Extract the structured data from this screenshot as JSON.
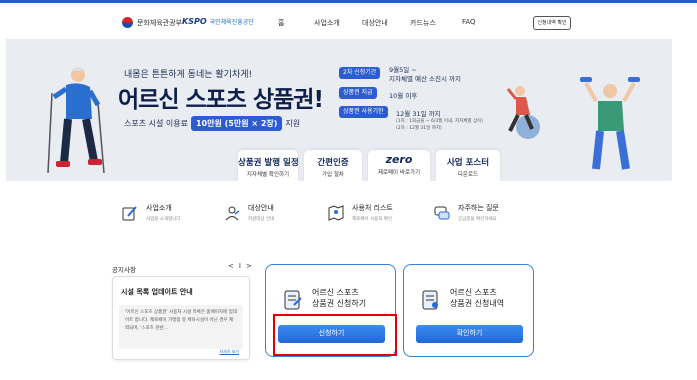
{
  "header": {
    "logo_mcst": "문화체육관광부",
    "logo_kspo_mark": "KSPO",
    "logo_kspo_sub": "국민체육진흥공단",
    "nav": [
      "홈",
      "사업소개",
      "대상안내",
      "카드뉴스",
      "FAQ"
    ],
    "check_button": "신청내역 확인"
  },
  "banner": {
    "subtitle": "내몸은 튼튼하게 동네는 활기차게!",
    "title": "어르신 스포츠 상품권!",
    "line_prefix": "스포츠 시설 이용료",
    "price": "10만원 (5만원 × 2장)",
    "line_suffix": "지원",
    "info": [
      {
        "tag": "2차 신청기간",
        "text": "9월5일 ~",
        "text2": "지자체별 예산 소진시 까지"
      },
      {
        "tag": "상품권 지급",
        "text": "10월 이후"
      },
      {
        "tag": "상품권 사용기한",
        "text": "12월 31일 까지",
        "small1": "(1차 : 1회급을 ~ 6/3월 이내, 지자체별 상이)",
        "small2": "(2차 : 12월 31일 까지)"
      }
    ],
    "quick_links": [
      {
        "title": "상품권 발행 일정",
        "sub": "지자체별 확인하기"
      },
      {
        "title": "간편인증",
        "sub": "가입 절차"
      },
      {
        "title": "zero",
        "sub": "제로페이 바로가기"
      },
      {
        "title": "사업 포스터",
        "sub": "다운로드"
      }
    ]
  },
  "services": [
    {
      "title": "사업소개",
      "sub": "사업을 소개합니다",
      "icon": "pencil-doc-icon"
    },
    {
      "title": "대상안내",
      "sub": "지원대상 안내",
      "icon": "person-icon"
    },
    {
      "title": "사용처 리스트",
      "sub": "제로페이 사용처 확인",
      "icon": "map-icon"
    },
    {
      "title": "자주하는 질문",
      "sub": "궁금증을 확인하세요",
      "icon": "chat-icon"
    }
  ],
  "notice": {
    "label": "공지사항",
    "prev": "<",
    "divider": "I",
    "next": ">",
    "title": "시설 목록 업데이트 안내",
    "body": "'어르신 스포츠 상품권' 사용처 시설 목록은 홈페이지에 업데이트 합니다. 제로페이 가맹점 중 체육시설이 아닌 경우 제외되며, '스포츠 관련…",
    "more": "자세히 보기"
  },
  "cards": [
    {
      "title_line1": "어르신 스포츠",
      "title_line2": "상품권 신청하기",
      "button": "신청하기"
    },
    {
      "title_line1": "어르신 스포츠",
      "title_line2": "상품권 신청내역",
      "button": "확인하기"
    }
  ],
  "colors": {
    "accent": "#2d5bd0",
    "button": "#2168d6",
    "highlight": "#e00000",
    "banner_bg": "#e9edf2"
  }
}
